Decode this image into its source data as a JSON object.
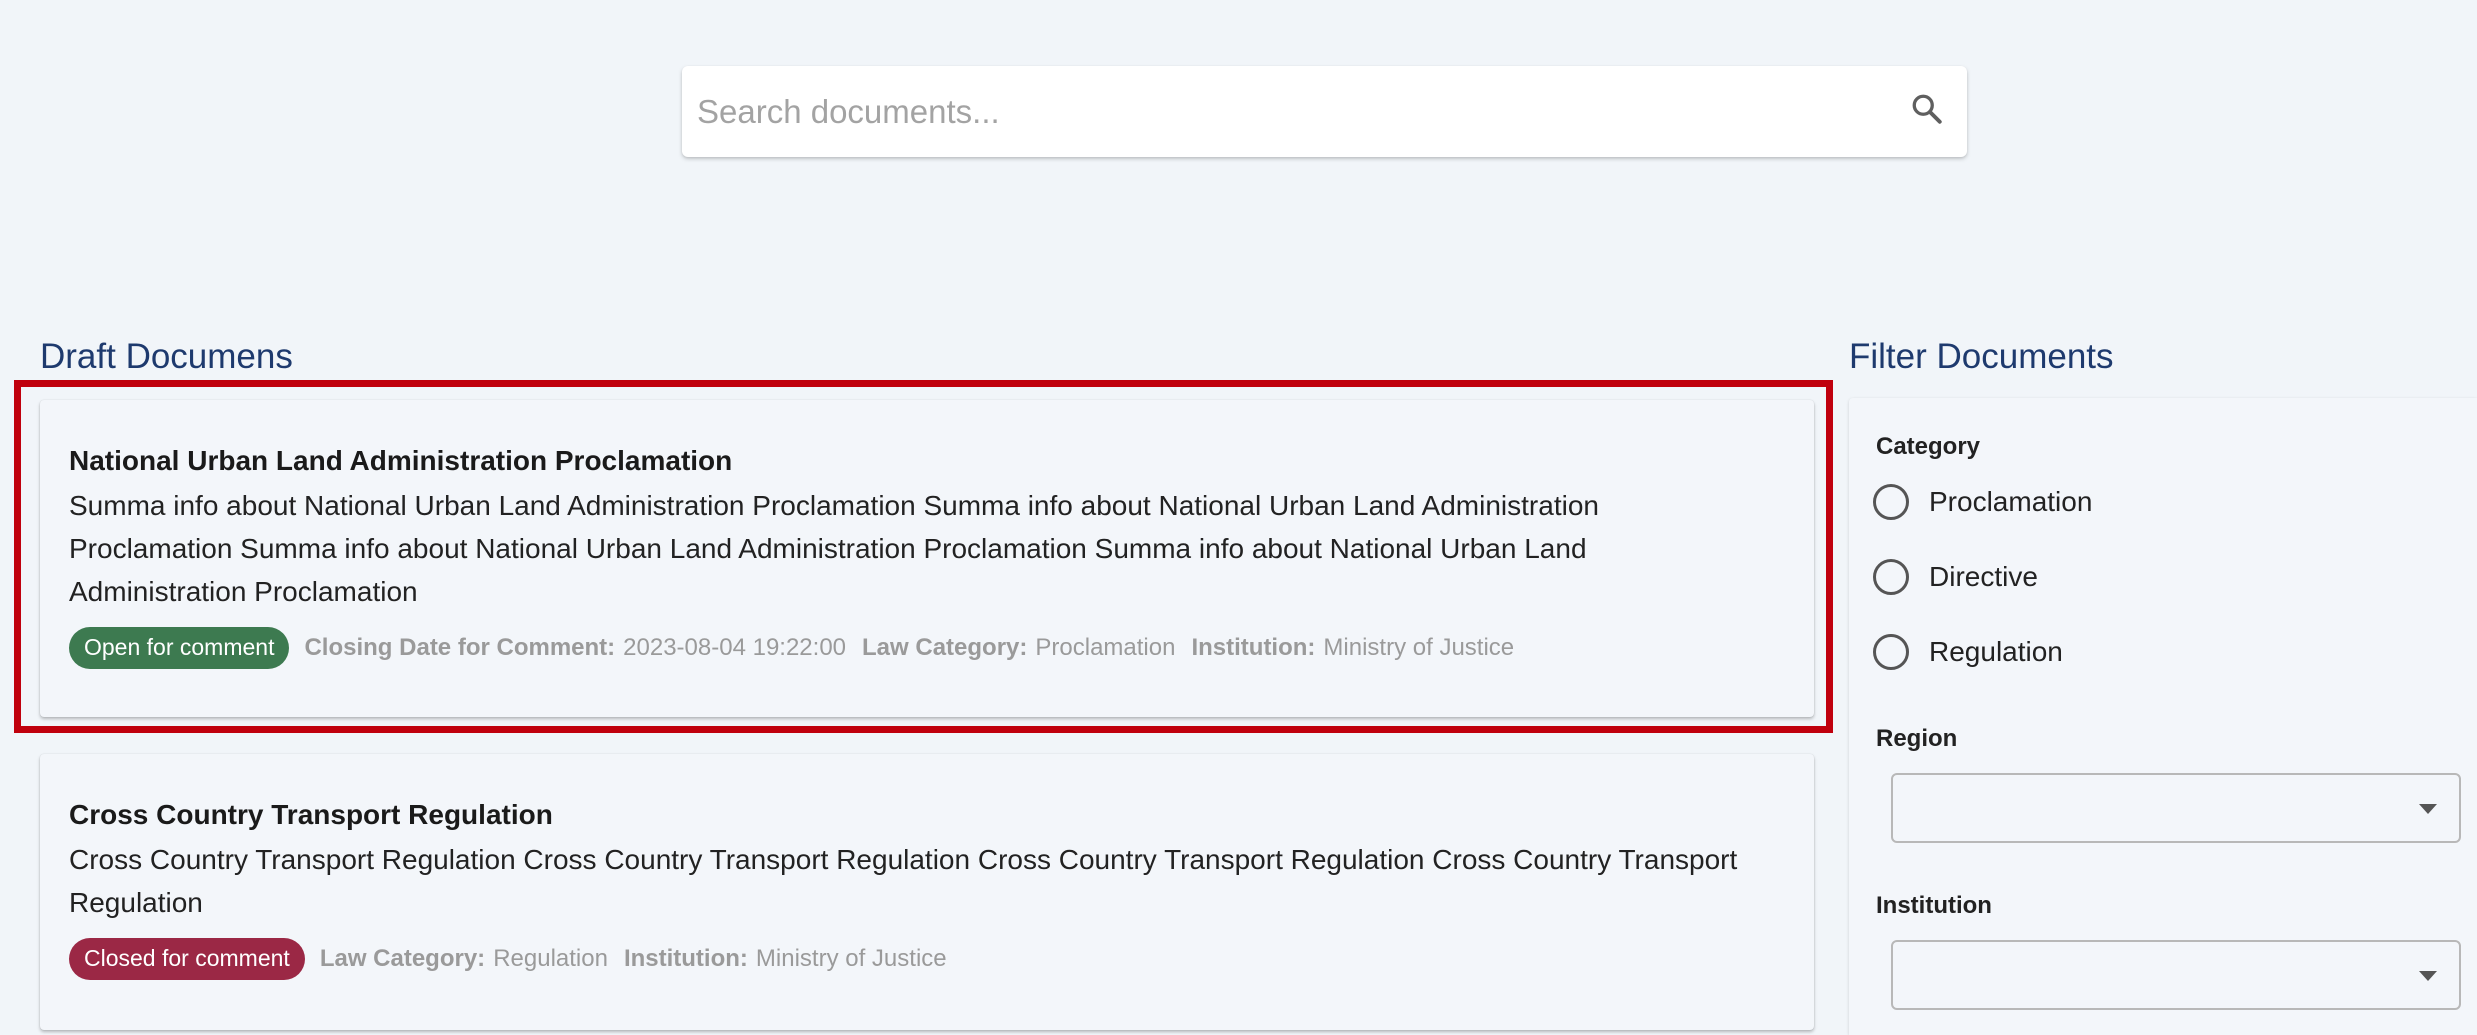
{
  "search": {
    "placeholder": "Search documents...",
    "icon": "search-icon"
  },
  "drafts": {
    "title": "Draft Documens",
    "documents": [
      {
        "title": "National Urban Land Administration Proclamation",
        "summary": "Summa info about National Urban Land Administration Proclamation Summa info about National Urban Land Administration Proclamation Summa info about National Urban Land Administration Proclamation Summa info about National Urban Land Administration Proclamation",
        "status": "Open for comment",
        "status_color": "#3d7a50",
        "closing_label": "Closing Date for Comment:",
        "closing_value": "2023-08-04 19:22:00",
        "category_label": "Law Category:",
        "category_value": "Proclamation",
        "institution_label": "Institution:",
        "institution_value": "Ministry of Justice"
      },
      {
        "title": "Cross Country Transport Regulation",
        "summary": "Cross Country Transport Regulation Cross Country Transport Regulation Cross Country Transport Regulation Cross Country Transport Regulation",
        "status": "Closed for comment",
        "status_color": "#9b2845",
        "category_label": "Law Category:",
        "category_value": "Regulation",
        "institution_label": "Institution:",
        "institution_value": "Ministry of Justice"
      }
    ]
  },
  "filter": {
    "title": "Filter Documents",
    "category_label": "Category",
    "categories": [
      "Proclamation",
      "Directive",
      "Regulation"
    ],
    "region_label": "Region",
    "region_value": "",
    "institution_label": "Institution",
    "institution_value": ""
  },
  "colors": {
    "highlight": "#c0000d",
    "title_blue": "#1e3a6e",
    "background": "#f1f5f9"
  }
}
